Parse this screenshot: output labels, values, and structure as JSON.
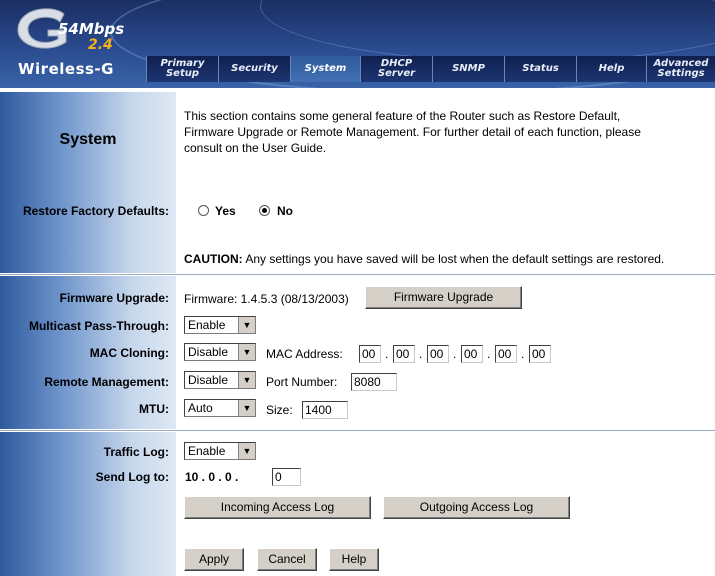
{
  "brand": {
    "speed": "54Mbps",
    "band": "2.4",
    "name": "Wireless-G"
  },
  "nav": {
    "tabs": [
      {
        "label": "Primary\nSetup"
      },
      {
        "label": "Security"
      },
      {
        "label": "System"
      },
      {
        "label": "DHCP\nServer"
      },
      {
        "label": "SNMP"
      },
      {
        "label": "Status"
      },
      {
        "label": "Help"
      },
      {
        "label": "Advanced\nSettings"
      }
    ],
    "active": "System"
  },
  "section_title": "System",
  "intro_lines": [
    "This section contains some general feature of the Router such as Restore Default,",
    "Firmware Upgrade or Remote Management. For further detail of each function, please",
    "consult on the User Guide."
  ],
  "restore": {
    "label": "Restore Factory Defaults:",
    "yes": "Yes",
    "no": "No",
    "selected": "No"
  },
  "caution": {
    "prefix": "CAUTION:",
    "text": " Any settings you have saved will be lost when the default settings are restored."
  },
  "firmware": {
    "label": "Firmware Upgrade:",
    "info": "Firmware: 1.4.5.3 (08/13/2003)",
    "button": "Firmware Upgrade"
  },
  "multicast": {
    "label": "Multicast Pass-Through:",
    "value": "Enable"
  },
  "mac_cloning": {
    "label": "MAC Cloning:",
    "value": "Disable",
    "address_label": "MAC Address:",
    "octets": [
      "00",
      "00",
      "00",
      "00",
      "00",
      "00"
    ],
    "sep": "."
  },
  "remote": {
    "label": "Remote Management:",
    "value": "Disable",
    "port_label": "Port Number:",
    "port": "8080"
  },
  "mtu": {
    "label": "MTU:",
    "value": "Auto",
    "size_label": "Size:",
    "size": "1400"
  },
  "traffic_log": {
    "label": "Traffic Log:",
    "value": "Enable"
  },
  "send_log": {
    "label": "Send Log to:",
    "prefix": "10 . 0 . 0 .",
    "last": "0"
  },
  "log_buttons": {
    "incoming": "Incoming Access Log",
    "outgoing": "Outgoing Access Log"
  },
  "actions": {
    "apply": "Apply",
    "cancel": "Cancel",
    "help": "Help"
  },
  "colors": {
    "header": "#1d3572",
    "active_tab": "#4270b4",
    "panel": "#6f95cc",
    "logo_accent": "#f3b21b"
  }
}
